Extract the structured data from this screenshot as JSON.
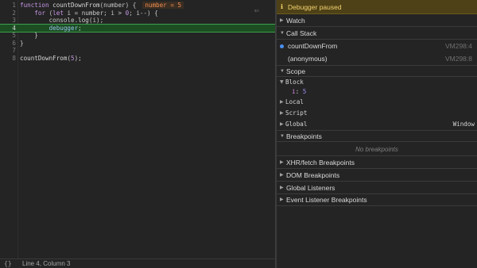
{
  "editor": {
    "inline_value": "number = 5",
    "lines": [
      {
        "num": "1",
        "code": [
          {
            "t": "function ",
            "c": "kw"
          },
          {
            "t": "countDownFrom",
            "c": "fn"
          },
          {
            "t": "(number) {",
            "c": ""
          }
        ]
      },
      {
        "num": "2",
        "code": [
          {
            "t": "    ",
            "c": ""
          },
          {
            "t": "for",
            "c": "kw"
          },
          {
            "t": " (",
            "c": ""
          },
          {
            "t": "let",
            "c": "kw"
          },
          {
            "t": " i = number; i > ",
            "c": ""
          },
          {
            "t": "0",
            "c": "num"
          },
          {
            "t": "; i--) {",
            "c": ""
          }
        ]
      },
      {
        "num": "3",
        "code": [
          {
            "t": "        console.",
            "c": ""
          },
          {
            "t": "log",
            "c": "fn"
          },
          {
            "t": "(i);",
            "c": ""
          }
        ]
      },
      {
        "num": "4",
        "code": [
          {
            "t": "        ",
            "c": ""
          },
          {
            "t": "debugger",
            "c": "hl"
          },
          {
            "t": ";",
            "c": ""
          }
        ]
      },
      {
        "num": "5",
        "code": [
          {
            "t": "    }",
            "c": ""
          }
        ]
      },
      {
        "num": "6",
        "code": [
          {
            "t": "}",
            "c": ""
          }
        ]
      },
      {
        "num": "7",
        "code": [
          {
            "t": "",
            "c": ""
          }
        ]
      },
      {
        "num": "8",
        "code": [
          {
            "t": "countDownFrom",
            "c": "fn"
          },
          {
            "t": "(",
            "c": ""
          },
          {
            "t": "5",
            "c": "num"
          },
          {
            "t": ");",
            "c": ""
          }
        ]
      }
    ],
    "active_line": 3
  },
  "statusbar": {
    "format_icon": "{}",
    "cursor_position": "Line 4, Column 3"
  },
  "debugger": {
    "banner": "Debugger paused",
    "sections": {
      "watch": "Watch",
      "call_stack": "Call Stack",
      "scope": "Scope",
      "breakpoints": "Breakpoints",
      "xhr": "XHR/fetch Breakpoints",
      "dom": "DOM Breakpoints",
      "global_listeners": "Global Listeners",
      "event_listeners": "Event Listener Breakpoints"
    },
    "call_stack": [
      {
        "name": "countDownFrom",
        "location": "VM298:4"
      },
      {
        "name": "(anonymous)",
        "location": "VM298:8"
      }
    ],
    "scope": {
      "block": {
        "label": "Block",
        "var_name": "i",
        "var_value": "5"
      },
      "local": "Local",
      "script": "Script",
      "global": {
        "label": "Global",
        "value": "Window"
      }
    },
    "no_breakpoints": "No breakpoints"
  },
  "colors": {
    "banner_bg": "#4e4117",
    "active_line_bg": "#1c4d23",
    "frame_dot": "#4a8ff0"
  }
}
